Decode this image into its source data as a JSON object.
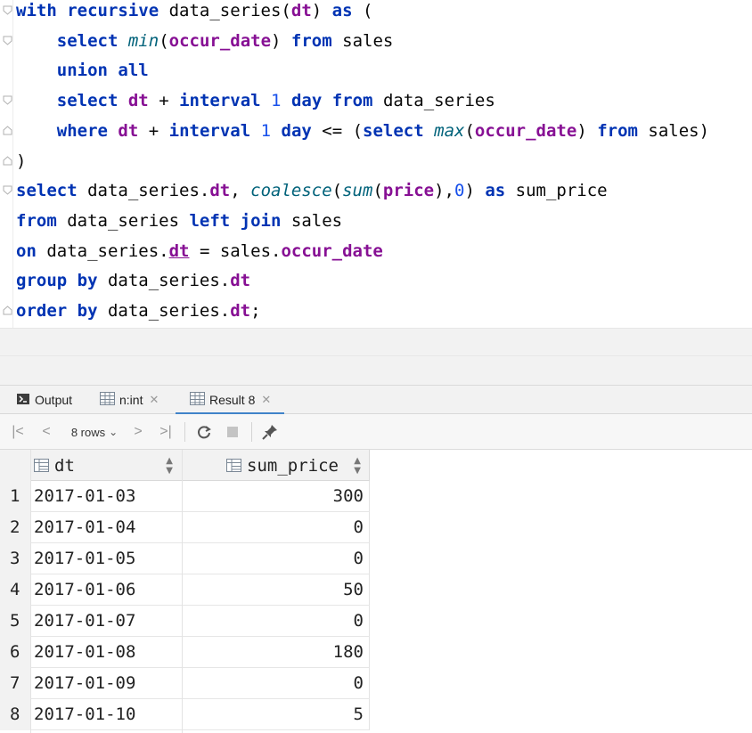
{
  "editor": {
    "lines": [
      [
        {
          "t": "with recursive",
          "c": "kw"
        },
        {
          "t": " data_series("
        },
        {
          "t": "dt",
          "c": "col"
        },
        {
          "t": ") "
        },
        {
          "t": "as",
          "c": "kw"
        },
        {
          "t": " ("
        }
      ],
      [
        {
          "t": "    "
        },
        {
          "t": "select",
          "c": "kw"
        },
        {
          "t": " "
        },
        {
          "t": "min",
          "c": "fn"
        },
        {
          "t": "("
        },
        {
          "t": "occur_date",
          "c": "col"
        },
        {
          "t": ") "
        },
        {
          "t": "from",
          "c": "kw"
        },
        {
          "t": " sales"
        }
      ],
      [
        {
          "t": "    "
        },
        {
          "t": "union all",
          "c": "kw"
        }
      ],
      [
        {
          "t": "    "
        },
        {
          "t": "select",
          "c": "kw"
        },
        {
          "t": " "
        },
        {
          "t": "dt",
          "c": "col"
        },
        {
          "t": " + "
        },
        {
          "t": "interval",
          "c": "kw"
        },
        {
          "t": " "
        },
        {
          "t": "1",
          "c": "num"
        },
        {
          "t": " "
        },
        {
          "t": "day",
          "c": "kw"
        },
        {
          "t": " "
        },
        {
          "t": "from",
          "c": "kw"
        },
        {
          "t": " data_series"
        }
      ],
      [
        {
          "t": "    "
        },
        {
          "t": "where",
          "c": "kw"
        },
        {
          "t": " "
        },
        {
          "t": "dt",
          "c": "col"
        },
        {
          "t": " + "
        },
        {
          "t": "interval",
          "c": "kw"
        },
        {
          "t": " "
        },
        {
          "t": "1",
          "c": "num"
        },
        {
          "t": " "
        },
        {
          "t": "day",
          "c": "kw"
        },
        {
          "t": " <= ("
        },
        {
          "t": "select",
          "c": "kw"
        },
        {
          "t": " "
        },
        {
          "t": "max",
          "c": "fn"
        },
        {
          "t": "("
        },
        {
          "t": "occur_date",
          "c": "col"
        },
        {
          "t": ") "
        },
        {
          "t": "from",
          "c": "kw"
        },
        {
          "t": " sales)"
        }
      ],
      [
        {
          "t": ")"
        }
      ],
      [
        {
          "t": "select",
          "c": "kw"
        },
        {
          "t": " data_series."
        },
        {
          "t": "dt",
          "c": "col"
        },
        {
          "t": ", "
        },
        {
          "t": "coalesce",
          "c": "fn"
        },
        {
          "t": "("
        },
        {
          "t": "sum",
          "c": "fn"
        },
        {
          "t": "("
        },
        {
          "t": "price",
          "c": "col"
        },
        {
          "t": "),"
        },
        {
          "t": "0",
          "c": "num"
        },
        {
          "t": ") "
        },
        {
          "t": "as",
          "c": "kw"
        },
        {
          "t": " sum_price"
        }
      ],
      [
        {
          "t": "from",
          "c": "kw"
        },
        {
          "t": " data_series "
        },
        {
          "t": "left join",
          "c": "kw"
        },
        {
          "t": " sales"
        }
      ],
      [
        {
          "t": "on",
          "c": "kw"
        },
        {
          "t": " data_series."
        },
        {
          "t": "dt",
          "c": "col ul"
        },
        {
          "t": " = sales."
        },
        {
          "t": "occur_date",
          "c": "col"
        }
      ],
      [
        {
          "t": "group by",
          "c": "kw"
        },
        {
          "t": " data_series."
        },
        {
          "t": "dt",
          "c": "col"
        }
      ],
      [
        {
          "t": "order by",
          "c": "kw"
        },
        {
          "t": " data_series."
        },
        {
          "t": "dt",
          "c": "col"
        },
        {
          "t": ";"
        }
      ]
    ]
  },
  "tabs": {
    "output_label": "Output",
    "nint_label": "n:int",
    "result_label": "Result 8",
    "close_glyph": "✕"
  },
  "toolbar": {
    "rows_label": "8 rows",
    "first_glyph": "|<",
    "prev_glyph": "<",
    "next_glyph": ">",
    "last_glyph": ">|",
    "dropdown_glyph": "⌄"
  },
  "grid": {
    "columns": [
      "dt",
      "sum_price"
    ],
    "rows": [
      {
        "n": "1",
        "dt": "2017-01-03",
        "sum_price": "300"
      },
      {
        "n": "2",
        "dt": "2017-01-04",
        "sum_price": "0"
      },
      {
        "n": "3",
        "dt": "2017-01-05",
        "sum_price": "0"
      },
      {
        "n": "4",
        "dt": "2017-01-06",
        "sum_price": "50"
      },
      {
        "n": "5",
        "dt": "2017-01-07",
        "sum_price": "0"
      },
      {
        "n": "6",
        "dt": "2017-01-08",
        "sum_price": "180"
      },
      {
        "n": "7",
        "dt": "2017-01-09",
        "sum_price": "0"
      },
      {
        "n": "8",
        "dt": "2017-01-10",
        "sum_price": "5"
      }
    ]
  },
  "colors": {
    "keyword": "#0033b3",
    "function": "#00627a",
    "column": "#871094",
    "number": "#1750eb",
    "active_tab": "#4083c9"
  }
}
